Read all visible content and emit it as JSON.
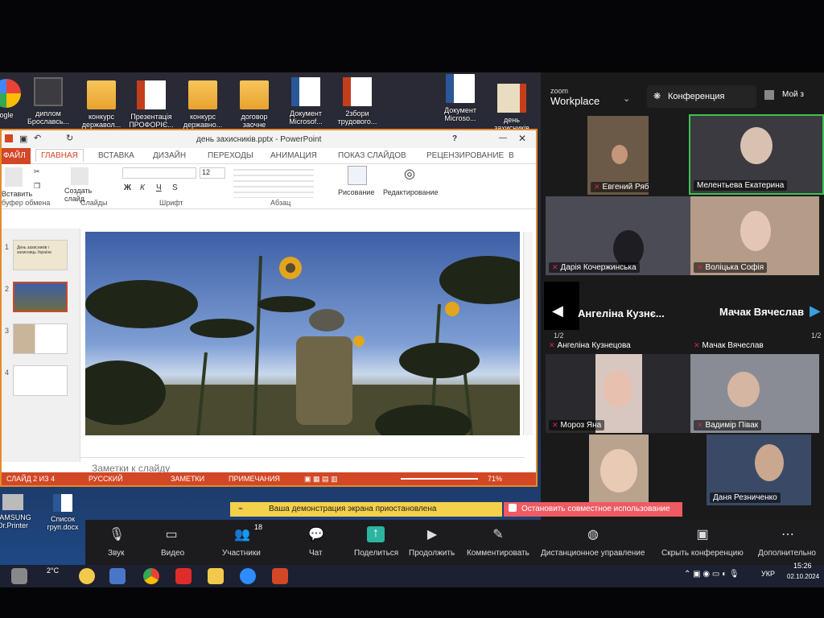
{
  "desktop": {
    "icons": [
      {
        "label": "ogle",
        "kind": "google"
      },
      {
        "label": "диплом Брославсь...",
        "kind": "book"
      },
      {
        "label": "конкурс державол...",
        "kind": "folder"
      },
      {
        "label": "Презентація ПРОФОРІЄ...",
        "kind": "ppt"
      },
      {
        "label": "конкурс державно...",
        "kind": "folder"
      },
      {
        "label": "договор заочне",
        "kind": "folder"
      },
      {
        "label": "Документ Microsof...",
        "kind": "word"
      },
      {
        "label": "2збори трудового...",
        "kind": "ppt"
      },
      {
        "label": "Документ Microso...",
        "kind": "word"
      },
      {
        "label": "день захисників",
        "kind": "ppt"
      }
    ],
    "bottom_icons": [
      {
        "label": "SAMSUNG Dr.Printer"
      },
      {
        "label": "Список груп.docx"
      }
    ]
  },
  "powerpoint": {
    "title": "день захисників.pptx - PowerPoint",
    "help": "?",
    "tabs": [
      "ФАЙЛ",
      "ГЛАВНАЯ",
      "ВСТАВКА",
      "ДИЗАЙН",
      "ПЕРЕХОДЫ",
      "АНИМАЦИЯ",
      "ПОКАЗ СЛАЙДОВ",
      "РЕЦЕНЗИРОВАНИЕ",
      "В"
    ],
    "ribbon": {
      "paste": "Вставить",
      "create_slide": "Создать слайд",
      "font_size": "12",
      "drawing": "Рисование",
      "editing": "Редактирование",
      "groups": [
        "буфер обмена",
        "Слайды",
        "Шрифт",
        "Абзац"
      ]
    },
    "thumbnails": [
      "1",
      "2",
      "3",
      "4"
    ],
    "thumb1_text": "День захисників і захисниць України",
    "notes_placeholder": "Заметки к слайду",
    "status": {
      "slide": "СЛАЙД 2 ИЗ 4",
      "language": "РУССКИЙ",
      "notes": "ЗАМЕТКИ",
      "comments": "ПРИМЕЧАНИЯ",
      "zoom": "71%"
    }
  },
  "zoom": {
    "brand_top": "zoom",
    "brand": "Workplace",
    "meeting": "Конференция",
    "my_label": "Мой з",
    "page_indicator": "1/2",
    "page_indicator_right": "1/2",
    "participants": [
      {
        "name": "Евгений Рябиненко",
        "muted": true
      },
      {
        "name": "Мелентьева Екатерина",
        "muted": false
      },
      {
        "name": "Дарія Кочержинська",
        "muted": true
      },
      {
        "name": "Воліцька Софія",
        "muted": true
      },
      {
        "name": "Ангеліна Кузнецова",
        "muted": true,
        "big": "Ангеліна Кузнє..."
      },
      {
        "name": "Мачак Вячеслав",
        "muted": true,
        "big": "Мачак Вячеслав"
      },
      {
        "name": "Мороз Яна",
        "muted": true
      },
      {
        "name": "Вадимір Півак",
        "muted": true
      },
      {
        "name": "Даня Резниченко",
        "muted": false
      }
    ],
    "notice": "Ваша демонстрация экрана приостановлена",
    "stop_share": "Остановить совместное использование",
    "participants_count": "18",
    "toolbar": {
      "audio": "Звук",
      "video": "Видео",
      "participants": "Участники",
      "chat": "Чат",
      "share": "Поделиться",
      "resume": "Продолжить",
      "annotate": "Комментировать",
      "remote": "Дистанционное управление",
      "hide": "Скрыть конференцию",
      "more": "Дополнительно"
    }
  },
  "taskbar": {
    "weather": "2°C",
    "language": "УКР",
    "time": "15:26",
    "date": "02.10.2024"
  }
}
